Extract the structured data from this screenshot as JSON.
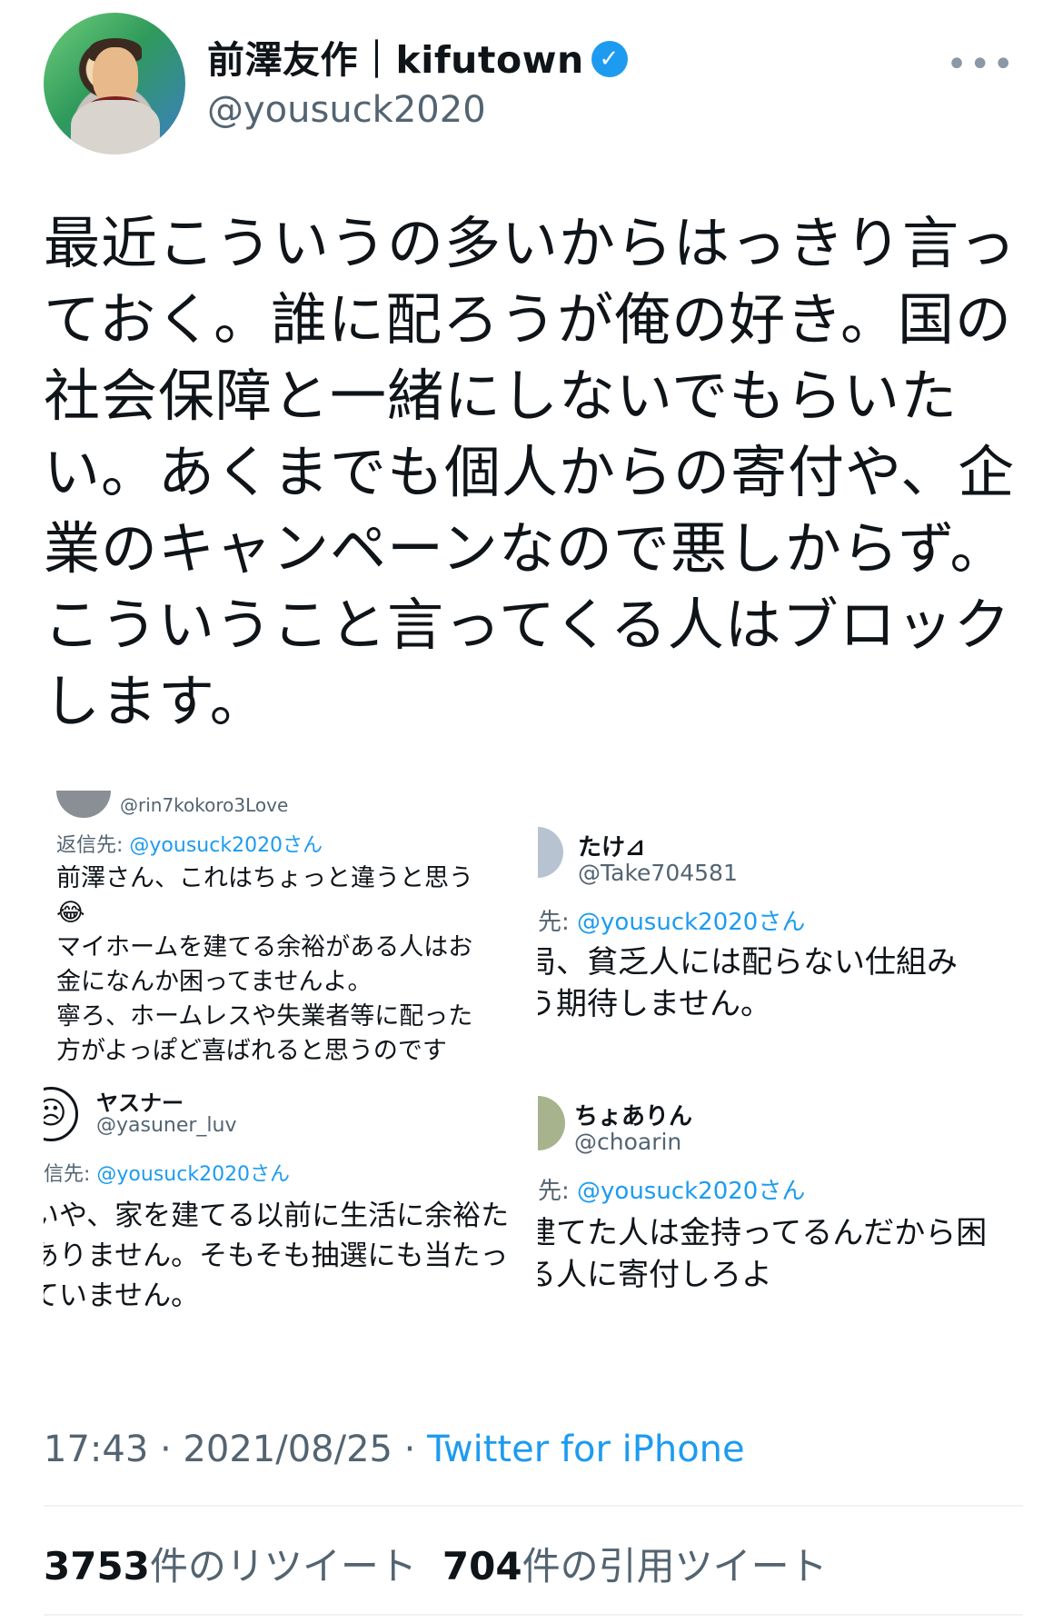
{
  "header": {
    "display_name": "前澤友作｜kifutown",
    "handle": "@yousuck2020",
    "verified_glyph": "✓",
    "more_glyph": "•••",
    "avatar_icon": "profile-avatar"
  },
  "tweet": {
    "lines": [
      "最近こういうの多いからはっきり言っ",
      "ておく。誰に配ろうが俺の好き。国の",
      "社会保障と一緒にしないでもらいた",
      "い。あくまでも個人からの寄付や、企",
      "業のキャンペーンなので悪しからず。",
      "こういうこと言ってくる人はブロック",
      "します。"
    ]
  },
  "media": {
    "panel1": {
      "handle": "@rin7kokoro3Love",
      "reply_prefix": "返信先: ",
      "reply_mention": "@yousuck2020さん",
      "body": [
        "前澤さん、これはちょっと違うと思う",
        "😂",
        "マイホームを建てる余裕がある人はお",
        "金になんか困ってませんよ。",
        "寧ろ、ホームレスや失業者等に配った",
        "方がよっぽど喜ばれると思うのです"
      ]
    },
    "panel2": {
      "name": "たけ⊿",
      "handle": "@Take704581",
      "reply_prefix": "先: ",
      "reply_mention": "@yousuck2020さん",
      "body": [
        "局、貧乏人には配らない仕組み",
        "う期待しません。"
      ]
    },
    "panel3": {
      "name": "ヤスナー",
      "handle": "@yasuner_luv",
      "reply_prefix": "信先: ",
      "reply_mention": "@yousuck2020さん",
      "body": [
        "いや、家を建てる以前に生活に余裕た",
        "ありません。そもそも抽選にも当たっ",
        "ていません。"
      ]
    },
    "panel4": {
      "name": "ちょありん",
      "handle": "@choarin",
      "reply_prefix": "先: ",
      "reply_mention": "@yousuck2020さん",
      "body": [
        "建てた人は金持ってるんだから困",
        "る人に寄付しろよ"
      ]
    }
  },
  "meta": {
    "time": "17:43 · 2021/08/25 · ",
    "source": "Twitter for iPhone"
  },
  "stats": {
    "retweets_count": "3753",
    "retweets_label": "件のリツイート",
    "quotes_count": "704",
    "quotes_label": "件の引用ツイート"
  },
  "colors": {
    "accent": "#1d9bf0",
    "muted": "#536471",
    "text": "#0f1419"
  }
}
